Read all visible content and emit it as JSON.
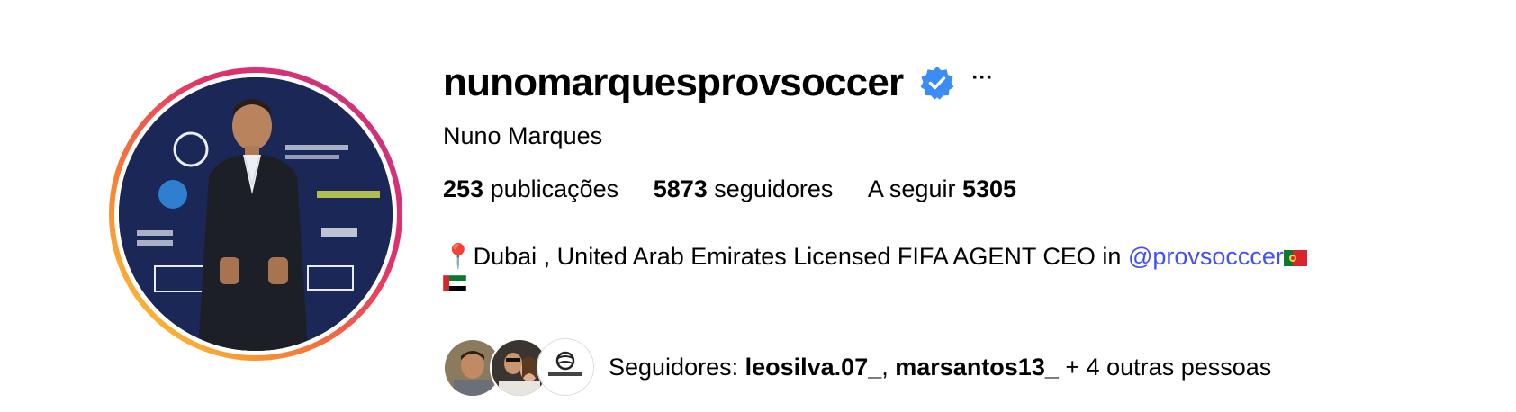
{
  "profile": {
    "username": "nunomarquesprovsoccer",
    "full_name": "Nuno Marques",
    "more_label": "···",
    "stats": {
      "posts_count": "253",
      "posts_label": "publicações",
      "followers_count": "5873",
      "followers_label": "seguidores",
      "following_label": "A seguir",
      "following_count": "5305"
    },
    "bio": {
      "pin": "📍",
      "text": "Dubai , United Arab Emirates Licensed FIFA AGENT CEO in ",
      "mention": "@provsocccer"
    },
    "followed_by": {
      "prefix": "Seguidores: ",
      "user1": "leosilva.07_",
      "separator": ", ",
      "user2": "marsantos13_",
      "suffix": " + 4 outras pessoas"
    }
  },
  "colors": {
    "verified": "#3b8df5",
    "link": "#4150f7",
    "ring_start": "#c13584",
    "ring_end": "#fcaf45"
  },
  "icons": [
    "verified-badge-icon",
    "more-options-icon",
    "portugal-flag-icon",
    "uae-flag-icon"
  ]
}
